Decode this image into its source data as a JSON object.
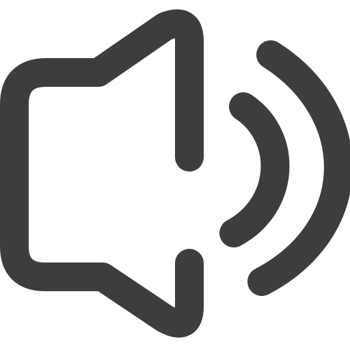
{
  "icon": {
    "name": "speaker-volume-icon",
    "color": "#3d3d3d",
    "background": "#ffffff"
  }
}
